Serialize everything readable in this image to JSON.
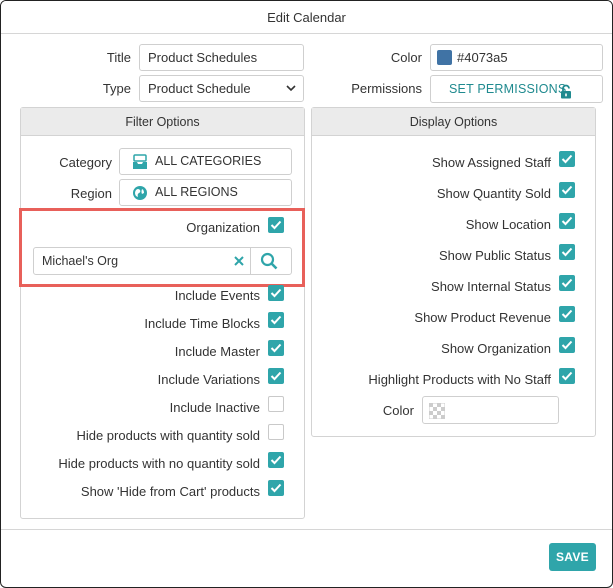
{
  "window": {
    "title": "Edit Calendar"
  },
  "form": {
    "title_label": "Title",
    "title_value": "Product Schedules",
    "type_label": "Type",
    "type_value": "Product Schedule",
    "color_label": "Color",
    "color_value": "#4073a5",
    "permissions_label": "Permissions",
    "permissions_button": "SET PERMISSIONS"
  },
  "filter_options": {
    "header": "Filter Options",
    "category_label": "Category",
    "category_button": "ALL CATEGORIES",
    "region_label": "Region",
    "region_button": "ALL REGIONS",
    "organization_label": "Organization",
    "organization_checked": true,
    "organization_value": "Michael's Org",
    "checkboxes": [
      {
        "label": "Include Events",
        "checked": true
      },
      {
        "label": "Include Time Blocks",
        "checked": true
      },
      {
        "label": "Include Master",
        "checked": true
      },
      {
        "label": "Include Variations",
        "checked": true
      },
      {
        "label": "Include Inactive",
        "checked": false
      },
      {
        "label": "Hide products with quantity sold",
        "checked": false
      },
      {
        "label": "Hide products with no quantity sold",
        "checked": true
      },
      {
        "label": "Show 'Hide from Cart' products",
        "checked": true
      }
    ]
  },
  "display_options": {
    "header": "Display Options",
    "checkboxes": [
      {
        "label": "Show Assigned Staff",
        "checked": true
      },
      {
        "label": "Show Quantity Sold",
        "checked": true
      },
      {
        "label": "Show Location",
        "checked": true
      },
      {
        "label": "Show Public Status",
        "checked": true
      },
      {
        "label": "Show Internal Status",
        "checked": true
      },
      {
        "label": "Show Product Revenue",
        "checked": true
      },
      {
        "label": "Show Organization",
        "checked": true
      },
      {
        "label": "Highlight Products with No Staff",
        "checked": true
      }
    ],
    "color_label": "Color"
  },
  "footer": {
    "save_label": "SAVE"
  },
  "theme": {
    "accent": "#2fa5aa",
    "highlight": "#e8605a",
    "link": "#1f8a8f"
  }
}
